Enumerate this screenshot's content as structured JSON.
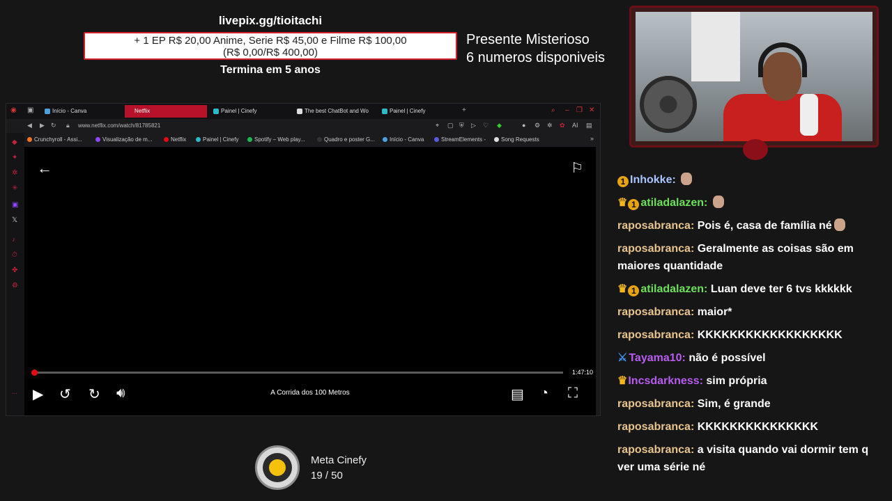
{
  "overlay": {
    "livepix_url": "livepix.gg/tioitachi",
    "goal_line1": "+ 1 EP R$ 20,00 Anime, Serie R$ 45,00 e Filme R$ 100,00",
    "goal_line2": "(R$ 0,00/R$ 400,00)",
    "goal_ends": "Termina em 5 anos",
    "mystery_line1": "Presente Misterioso",
    "mystery_line2": "6 numeros disponiveis"
  },
  "browser": {
    "tabs": [
      {
        "label": "Início - Canva",
        "active": false
      },
      {
        "label": "Netflix",
        "active": true
      },
      {
        "label": "Painel | Cinefy",
        "active": false
      },
      {
        "label": "The best ChatBot and Wo",
        "active": false
      },
      {
        "label": "Painel | Cinefy",
        "active": false
      }
    ],
    "url": "www.netflix.com/watch/81785821",
    "bookmarks": [
      "Crunchyroll - Assi...",
      "Visualização de m...",
      "Netflix",
      "Painel | Cinefy",
      "Spotify – Web play...",
      "Quadro e poster G...",
      "Início - Canva",
      "StreamElements -",
      "Song Requests"
    ],
    "ext_ai_label": "AI"
  },
  "player": {
    "time_remaining": "1:47:10",
    "movie_title": "A Corrida dos 100 Metros",
    "progress": 0.005
  },
  "meta": {
    "label": "Meta Cinefy",
    "count": "19  /  50"
  },
  "chat": [
    {
      "user": "Inhokke",
      "color": "#a9c4ff",
      "badges": [
        "one"
      ],
      "text": "",
      "emote": true
    },
    {
      "user": "atiladalazen",
      "color": "#6de05a",
      "badges": [
        "crown",
        "one"
      ],
      "text": "",
      "emote": true
    },
    {
      "user": "raposabranca",
      "color": "#e8c48e",
      "badges": [],
      "text": "Pois é, casa de família né",
      "emote": true
    },
    {
      "user": "raposabranca",
      "color": "#e8c48e",
      "badges": [],
      "text": "Geralmente as coisas são em maiores quantidade",
      "emote": false
    },
    {
      "user": "atiladalazen",
      "color": "#6de05a",
      "badges": [
        "crown",
        "one"
      ],
      "text": "Luan deve ter 6 tvs kkkkkk",
      "emote": false
    },
    {
      "user": "raposabranca",
      "color": "#e8c48e",
      "badges": [],
      "text": "maior*",
      "emote": false
    },
    {
      "user": "raposabranca",
      "color": "#e8c48e",
      "badges": [],
      "text": "KKKKKKKKKKKKKKKKKK",
      "emote": false
    },
    {
      "user": "Tayama10",
      "color": "#b85cf0",
      "badges": [
        "sword"
      ],
      "text": "não é possível",
      "emote": false
    },
    {
      "user": "Incsdarkness",
      "color": "#b85cf0",
      "badges": [
        "crown"
      ],
      "text": "sim própria",
      "emote": false
    },
    {
      "user": "raposabranca",
      "color": "#e8c48e",
      "badges": [],
      "text": "Sim, é grande",
      "emote": false
    },
    {
      "user": "raposabranca",
      "color": "#e8c48e",
      "badges": [],
      "text": "KKKKKKKKKKKKKKK",
      "emote": false
    },
    {
      "user": "raposabranca",
      "color": "#e8c48e",
      "badges": [],
      "text": "a visita quando vai dormir tem q ver uma série né",
      "emote": false
    }
  ]
}
